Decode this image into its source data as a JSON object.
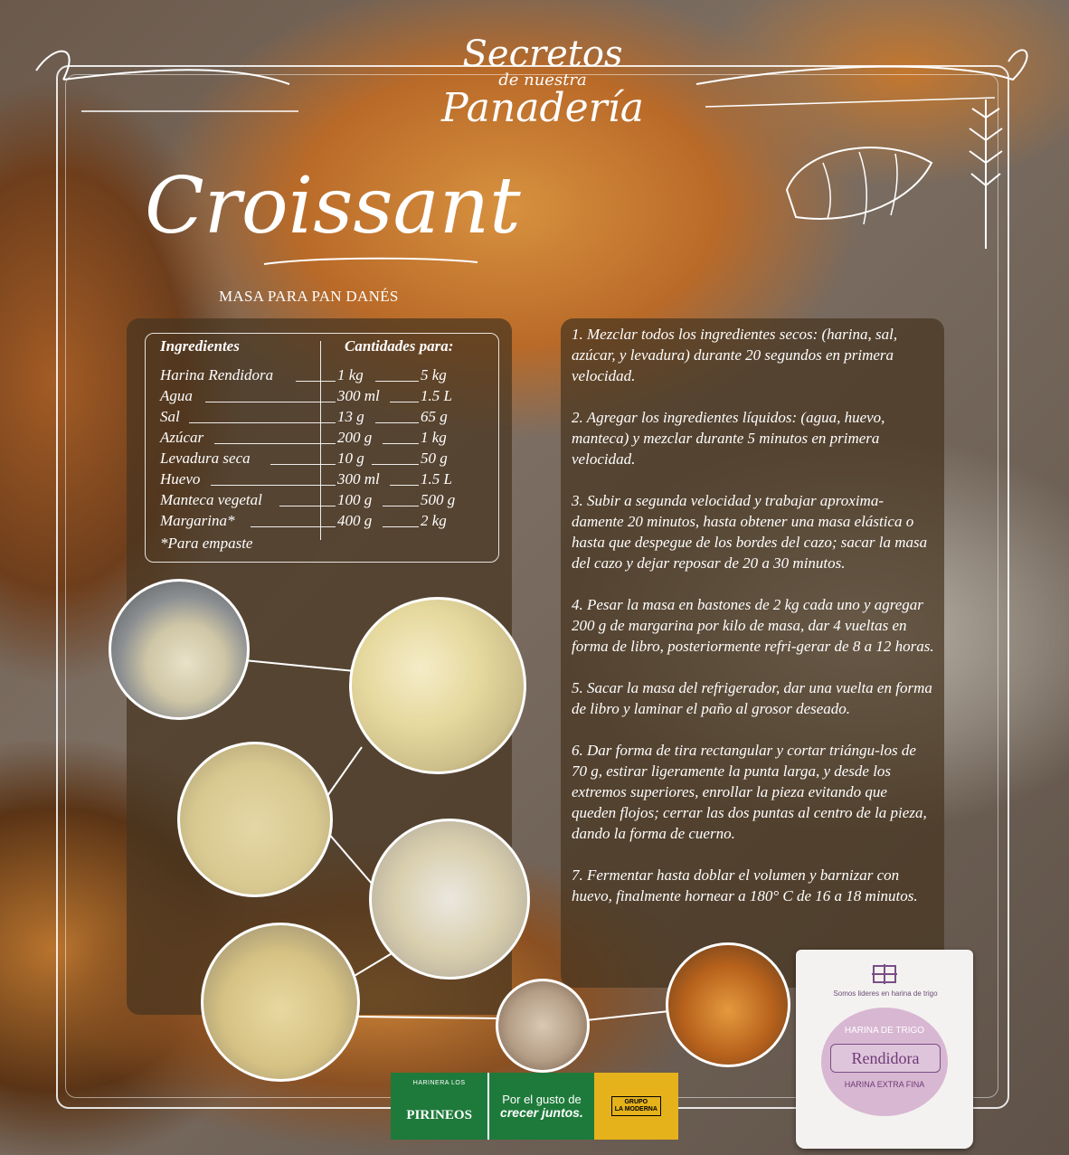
{
  "brand": {
    "line1": "Secretos",
    "line2": "de nuestra",
    "line3": "Panadería"
  },
  "title": "Croissant",
  "subtitle": "MASA PARA PAN DANÉS",
  "ingredients": {
    "header_name": "Ingredientes",
    "header_qty": "Cantidades para:",
    "rows": [
      {
        "name": "Harina Rendidora",
        "q1": "1 kg",
        "q2": "5 kg"
      },
      {
        "name": "Agua",
        "q1": "300 ml",
        "q2": "1.5 L"
      },
      {
        "name": "Sal",
        "q1": "13 g",
        "q2": "65 g"
      },
      {
        "name": "Azúcar",
        "q1": "200 g",
        "q2": "1 kg"
      },
      {
        "name": "Levadura seca",
        "q1": "10 g",
        "q2": "50 g"
      },
      {
        "name": "Huevo",
        "q1": "300 ml",
        "q2": "1.5 L"
      },
      {
        "name": "Manteca vegetal",
        "q1": "100 g",
        "q2": "500 g"
      },
      {
        "name": "Margarina*",
        "q1": "400 g",
        "q2": "2 kg"
      }
    ],
    "note": "*Para empaste"
  },
  "steps": [
    "1. Mezclar todos los ingredientes secos: (harina, sal, azúcar, y levadura) durante 20 segundos en primera velocidad.",
    "2. Agregar los ingredientes líquidos: (agua, huevo, manteca) y mezclar durante 5 minutos en primera velocidad.",
    "3. Subir a segunda velocidad y trabajar aproxima-damente 20 minutos, hasta obtener una masa elástica o hasta que despegue de los bordes del cazo; sacar la masa del cazo y dejar reposar de 20 a 30 minutos.",
    "4. Pesar la masa en bastones de 2 kg cada uno y agregar 200 g de margarina por kilo de masa, dar 4 vueltas en forma de libro, posteriormente refri-gerar de 8 a 12 horas.",
    "5. Sacar la masa del refrigerador, dar una vuelta en forma de libro y laminar el paño al grosor deseado.",
    "6. Dar forma de tira rectangular y cortar triángu-los de 70 g, estirar ligeramente la punta larga, y desde los extremos superiores, enrollar la pieza evitando que queden flojos; cerrar las dos puntas al centro de la pieza, dando la forma de cuerno.",
    "7. Fermentar hasta doblar el volumen y barnizar con huevo, finalmente hornear a 180° C de 16 a 18 minutos."
  ],
  "bag": {
    "sub": "Somos lideres en harina de trigo",
    "type": "HARINA DE TRIGO",
    "name": "Rendidora",
    "desc": "HARINA EXTRA FINA"
  },
  "logos": {
    "harinera_small": "HARINERA LOS",
    "harinera_big": "PIRINEOS",
    "slogan_1": "Por el gusto de",
    "slogan_2": "crecer juntos.",
    "grupo": "GRUPO",
    "grupo_name": "LA MODERNA"
  }
}
